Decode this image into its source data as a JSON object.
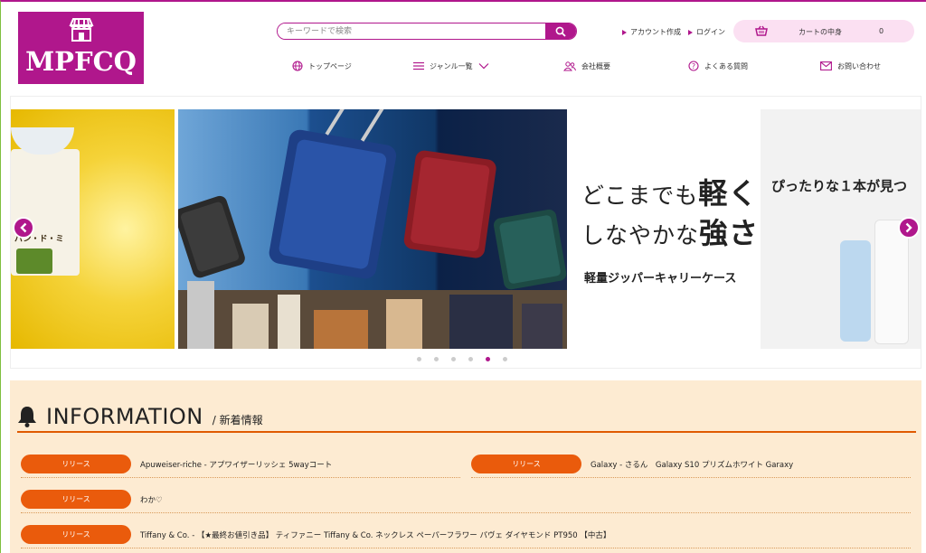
{
  "brand": {
    "name": "MPFCQ",
    "color": "#b0178c",
    "icon": "storefront-icon"
  },
  "search": {
    "placeholder": "キーワードで検索",
    "icon": "search-icon"
  },
  "account": {
    "create_label": "アカウント作成",
    "login_label": "ログイン"
  },
  "cart": {
    "label": "カートの中身",
    "count": "0",
    "icon": "basket-icon"
  },
  "nav": [
    {
      "label": "トップページ",
      "icon": "globe-icon"
    },
    {
      "label": "ジャンル一覧",
      "icon": "menu-icon"
    },
    {
      "label": "会社概要",
      "icon": "people-icon"
    },
    {
      "label": "よくある質問",
      "icon": "question-icon"
    },
    {
      "label": "お問い合わせ",
      "icon": "mail-icon"
    }
  ],
  "carousel": {
    "left_product_label": "パン・ド・ミ",
    "promo_line1_a": "どこまでも",
    "promo_line1_b": "軽く",
    "promo_line2_a": "しなやかな",
    "promo_line2_b": "強さ",
    "promo_line3": "軽量ジッパーキャリーケース",
    "right_text": "ぴったりな１本が見つ",
    "dot_count": 6,
    "active_dot": 5
  },
  "info": {
    "title": "INFORMATION",
    "subtitle": "/ 新着情報",
    "icon": "bell-icon",
    "accent": "#ea5b0c",
    "items": [
      {
        "badge": "リリース",
        "text": "Apuweiser-riche - アプワイザーリッシェ 5wayコート"
      },
      {
        "badge": "リリース",
        "text": "Galaxy - さるん　Galaxy S10 プリズムホワイト Garaxy"
      },
      {
        "badge": "リリース",
        "text": "わか♡"
      },
      {
        "badge": "リリース",
        "text": "Tiffany & Co. - 【★最終お値引き品】 ティファニー Tiffany & Co. ネックレス ペーパーフラワー パヴェ ダイヤモンド PT950 【中古】"
      }
    ]
  }
}
